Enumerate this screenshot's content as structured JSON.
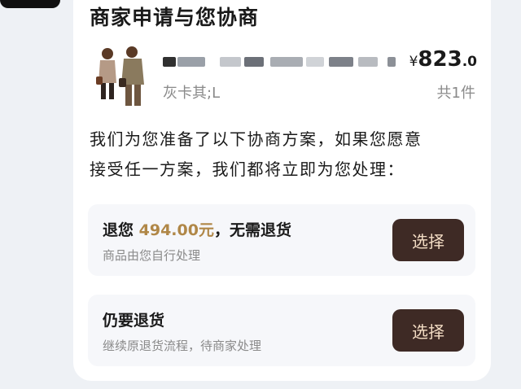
{
  "title": "商家申请与您协商",
  "product": {
    "name_redacted": "",
    "price_symbol": "¥",
    "price_integer": "823",
    "price_decimal": ".0",
    "variant": "灰卡其;L",
    "quantity": "共1件"
  },
  "intro_line1": "我们为您准备了以下协商方案，如果您愿意",
  "intro_line2": "接受任一方案，我们都将立即为您处理：",
  "options": [
    {
      "heading_prefix": "退您 ",
      "amount": "494.00元",
      "heading_suffix": "，无需退货",
      "subtitle": "商品由您自行处理",
      "button_label": "选择"
    },
    {
      "heading": "仍要退货",
      "subtitle": "继续原退货流程，待商家处理",
      "button_label": "选择"
    }
  ],
  "colors": {
    "accent_amount": "#b08747",
    "button_bg": "#3e2a25",
    "button_text": "#f3dcc4",
    "page_bg": "#eef1f5"
  }
}
